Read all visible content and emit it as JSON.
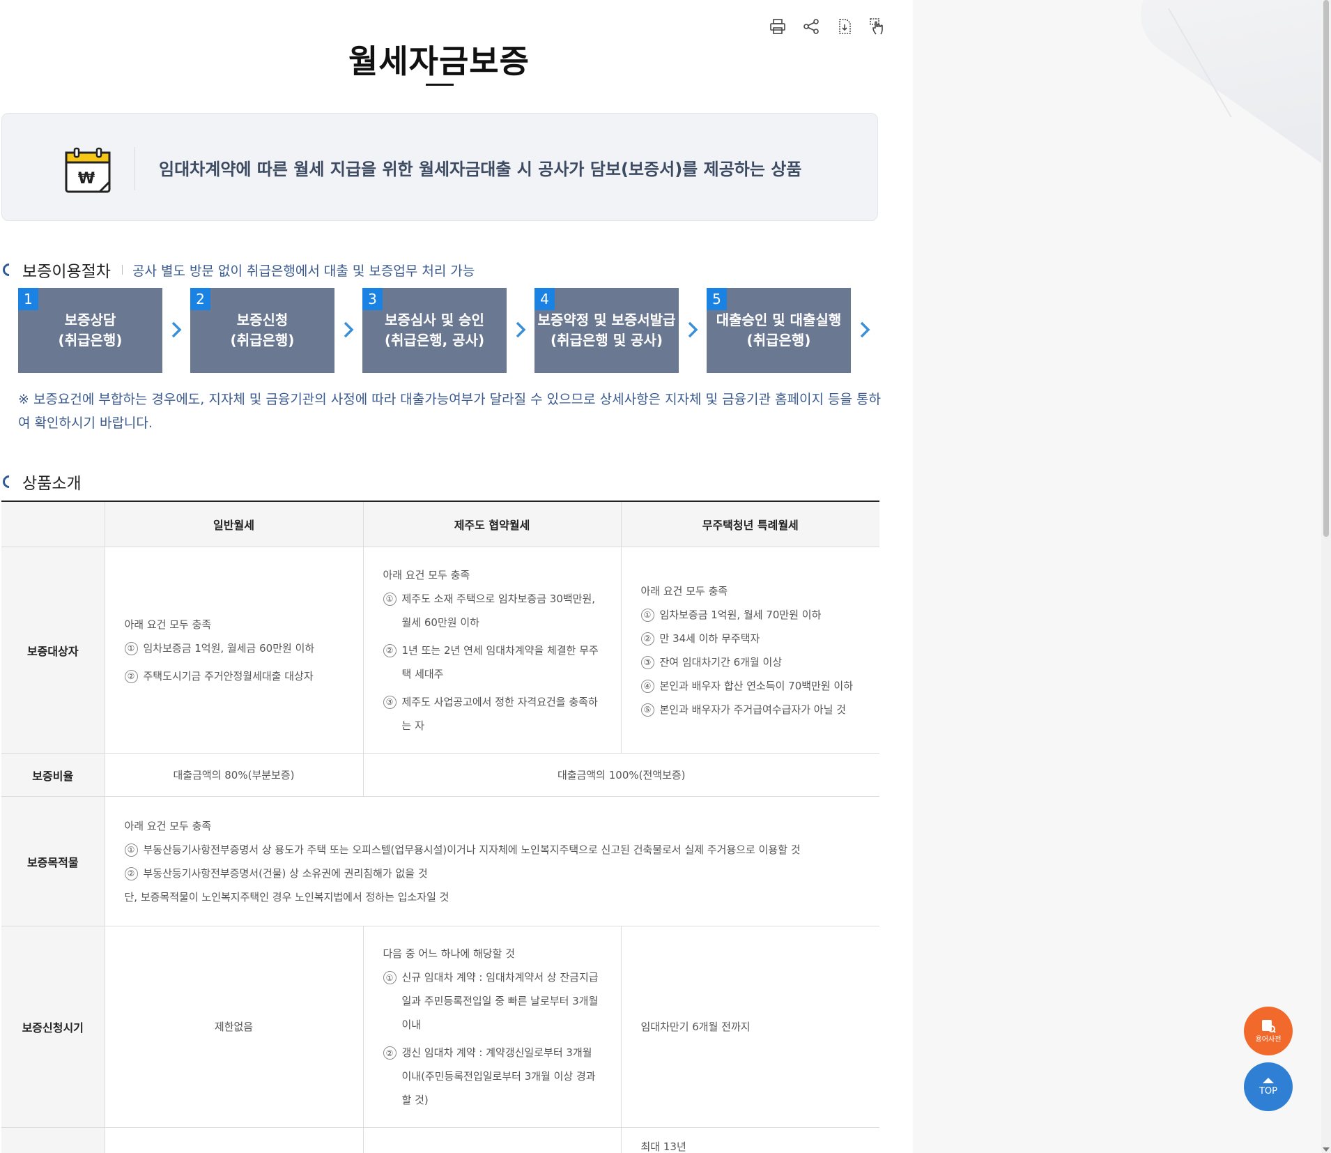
{
  "toolbar": {
    "print_icon": "print-icon",
    "share_icon": "share-icon",
    "download_icon": "document-download-icon",
    "gesture_icon": "touch-icon"
  },
  "page": {
    "title": "월세자금보증"
  },
  "intro": {
    "icon": "calendar-won-icon",
    "text": "임대차계약에 따른 월세 지급을 위한 월세자금대출 시 공사가 담보(보증서)를 제공하는 상품"
  },
  "procedure": {
    "heading": "보증이용절차",
    "subtext": "공사 별도 방문 없이 취급은행에서 대출 및 보증업무 처리 가능",
    "steps": [
      {
        "num": "1",
        "line1": "보증상담",
        "line2": "(취급은행)"
      },
      {
        "num": "2",
        "line1": "보증신청",
        "line2": "(취급은행)"
      },
      {
        "num": "3",
        "line1": "보증심사 및 승인",
        "line2": "(취급은행, 공사)"
      },
      {
        "num": "4",
        "line1": "보증약정 및 보증서발급",
        "line2": "(취급은행 및 공사)"
      },
      {
        "num": "5",
        "line1": "대출승인 및 대출실행",
        "line2": "(취급은행)"
      }
    ],
    "notice": "※ 보증요건에 부합하는 경우에도, 지자체 및 금융기관의 사정에 따라 대출가능여부가 달라질 수 있으므로 상세사항은 지자체 및 금융기관 홈페이지 등을 통하여 확인하시기 바랍니다."
  },
  "product": {
    "heading": "상품소개",
    "columns": [
      "일반월세",
      "제주도 협약월세",
      "무주택청년 특례월세"
    ],
    "rows": {
      "target": {
        "label": "보증대상자",
        "general": {
          "title": "아래 요건 모두 충족",
          "items": [
            "임차보증금 1억원, 월세금 60만원 이하",
            "주택도시기금 주거안정월세대출 대상자"
          ]
        },
        "jeju": {
          "title": "아래 요건 모두 충족",
          "items": [
            "제주도 소재 주택으로 임차보증금 30백만원, 월세 60만원 이하",
            "1년 또는 2년 연세 임대차계약을 체결한 무주택 세대주",
            "제주도 사업공고에서 정한 자격요건을 충족하는 자"
          ]
        },
        "youth": {
          "title": "아래 요건 모두 충족",
          "items": [
            "임차보증금 1억원, 월세 70만원 이하",
            "만 34세 이하 무주택자",
            "잔여 임대차기간 6개월 이상",
            "본인과 배우자 합산 연소득이 70백만원 이하",
            "본인과 배우자가 주거급여수급자가 아닐 것"
          ]
        }
      },
      "ratio": {
        "label": "보증비율",
        "general": "대출금액의 80%(부분보증)",
        "others": "대출금액의 100%(전액보증)"
      },
      "collateral": {
        "label": "보증목적물",
        "title": "아래 요건 모두 충족",
        "items": [
          "부동산등기사항전부증명서 상 용도가 주택 또는 오피스텔(업무용시설)이거나 지자체에 노인복지주택으로 신고된 건축물로서 실제 주거용으로 이용할 것",
          "부동산등기사항전부증명서(건물) 상 소유권에 권리침해가 없을 것"
        ],
        "note": "단, 보증목적물이 노인복지주택인 경우 노인복지법에서 정하는 입소자일 것"
      },
      "timing": {
        "label": "보증신청시기",
        "general": "제한없음",
        "jeju": {
          "title": "다음 중 어느 하나에 해당할 것",
          "items": [
            "신규 임대차 계약 : 임대차계약서 상 잔금지급일과 주민등록전입일 중 빠른 날로부터 3개월 이내",
            "갱신 임대차 계약 : 계약갱신일로부터 3개월 이내(주민등록전입일로부터 3개월 이상 경과할 것)"
          ]
        },
        "youth": "임대차만기 6개월 전까지"
      },
      "partial": {
        "youth": "최대 13년"
      }
    },
    "circled_numbers": [
      "①",
      "②",
      "③",
      "④",
      "⑤"
    ]
  },
  "fab": {
    "dictionary_label": "용어사전",
    "top_label": "TOP"
  },
  "colors": {
    "step_bg": "#6b7891",
    "step_num_bg": "#1a82e2",
    "accent_text": "#3b5a8f",
    "dict_button": "#f26a2b",
    "top_button": "#2f80d4"
  }
}
